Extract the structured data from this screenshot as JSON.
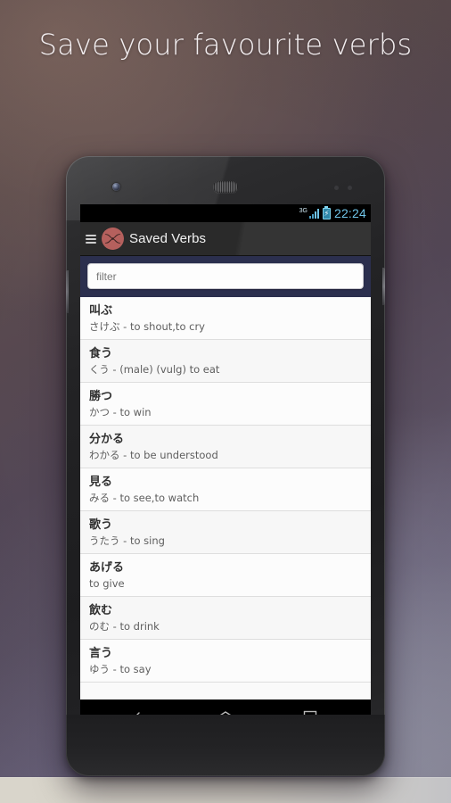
{
  "promo": {
    "headline": "Save your favourite verbs"
  },
  "colors": {
    "logo_red": "#b5605d",
    "filter_bar_navy": "#2b2f4e",
    "action_bar_dark": "#2f2f2f",
    "status_accent": "#6fc4e8",
    "list_background": "#fafafa"
  },
  "device": {
    "status_bar": {
      "network_label": "3G",
      "battery_icon": "battery-charging-icon",
      "signal_icon": "signal-bars-icon",
      "clock": "22:24"
    },
    "action_bar": {
      "menu_icon": "hamburger-menu-icon",
      "logo_icon": "app-logo-infinity-icon",
      "title": "Saved Verbs"
    },
    "filter": {
      "placeholder": "filter",
      "value": ""
    },
    "verbs": [
      {
        "kanji": "叫ぶ",
        "reading": "さけぶ - to shout,to cry"
      },
      {
        "kanji": "食う",
        "reading": "くう - (male) (vulg) to eat"
      },
      {
        "kanji": "勝つ",
        "reading": "かつ - to win"
      },
      {
        "kanji": "分かる",
        "reading": "わかる - to be understood"
      },
      {
        "kanji": "見る",
        "reading": "みる - to see,to watch"
      },
      {
        "kanji": "歌う",
        "reading": "うたう - to sing"
      },
      {
        "kanji": "あげる",
        "reading": "to give"
      },
      {
        "kanji": "飲む",
        "reading": "のむ - to drink"
      },
      {
        "kanji": "言う",
        "reading": "ゆう - to say"
      }
    ],
    "nav_bar": {
      "back_icon": "back-arrow-icon",
      "home_icon": "home-icon",
      "recents_icon": "recent-apps-icon"
    }
  }
}
